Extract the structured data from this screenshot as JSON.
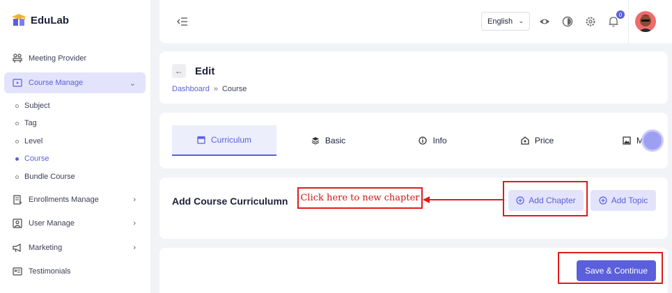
{
  "brand": {
    "name": "EduLab"
  },
  "sidebar": {
    "items": [
      {
        "label": "Meeting Provider",
        "icon": "meeting-icon"
      },
      {
        "label": "Course Manage",
        "icon": "course-icon"
      },
      {
        "label": "Enrollments Manage",
        "icon": "enroll-icon"
      },
      {
        "label": "User Manage",
        "icon": "user-icon"
      },
      {
        "label": "Marketing",
        "icon": "megaphone-icon"
      },
      {
        "label": "Testimonials",
        "icon": "testimonial-icon"
      }
    ],
    "sub_items": [
      "Subject",
      "Tag",
      "Level",
      "Course",
      "Bundle Course"
    ]
  },
  "header": {
    "language": "English",
    "notification_count": "0"
  },
  "page": {
    "title": "Edit",
    "breadcrumb": {
      "link": "Dashboard",
      "separator": "»",
      "current": "Course"
    }
  },
  "tabs": [
    "Curriculum",
    "Basic",
    "Info",
    "Price",
    "Medi"
  ],
  "curriculum": {
    "title": "Add Course Curriculumn",
    "add_chapter": "Add Chapter",
    "add_topic": "Add Topic"
  },
  "footer": {
    "save_label": "Save & Continue"
  },
  "annotation": {
    "callout": "Click here to new chapter"
  },
  "colors": {
    "accent": "#5b5fdc",
    "accent_light": "#e3e4fb",
    "annotation": "#e01a1a"
  }
}
